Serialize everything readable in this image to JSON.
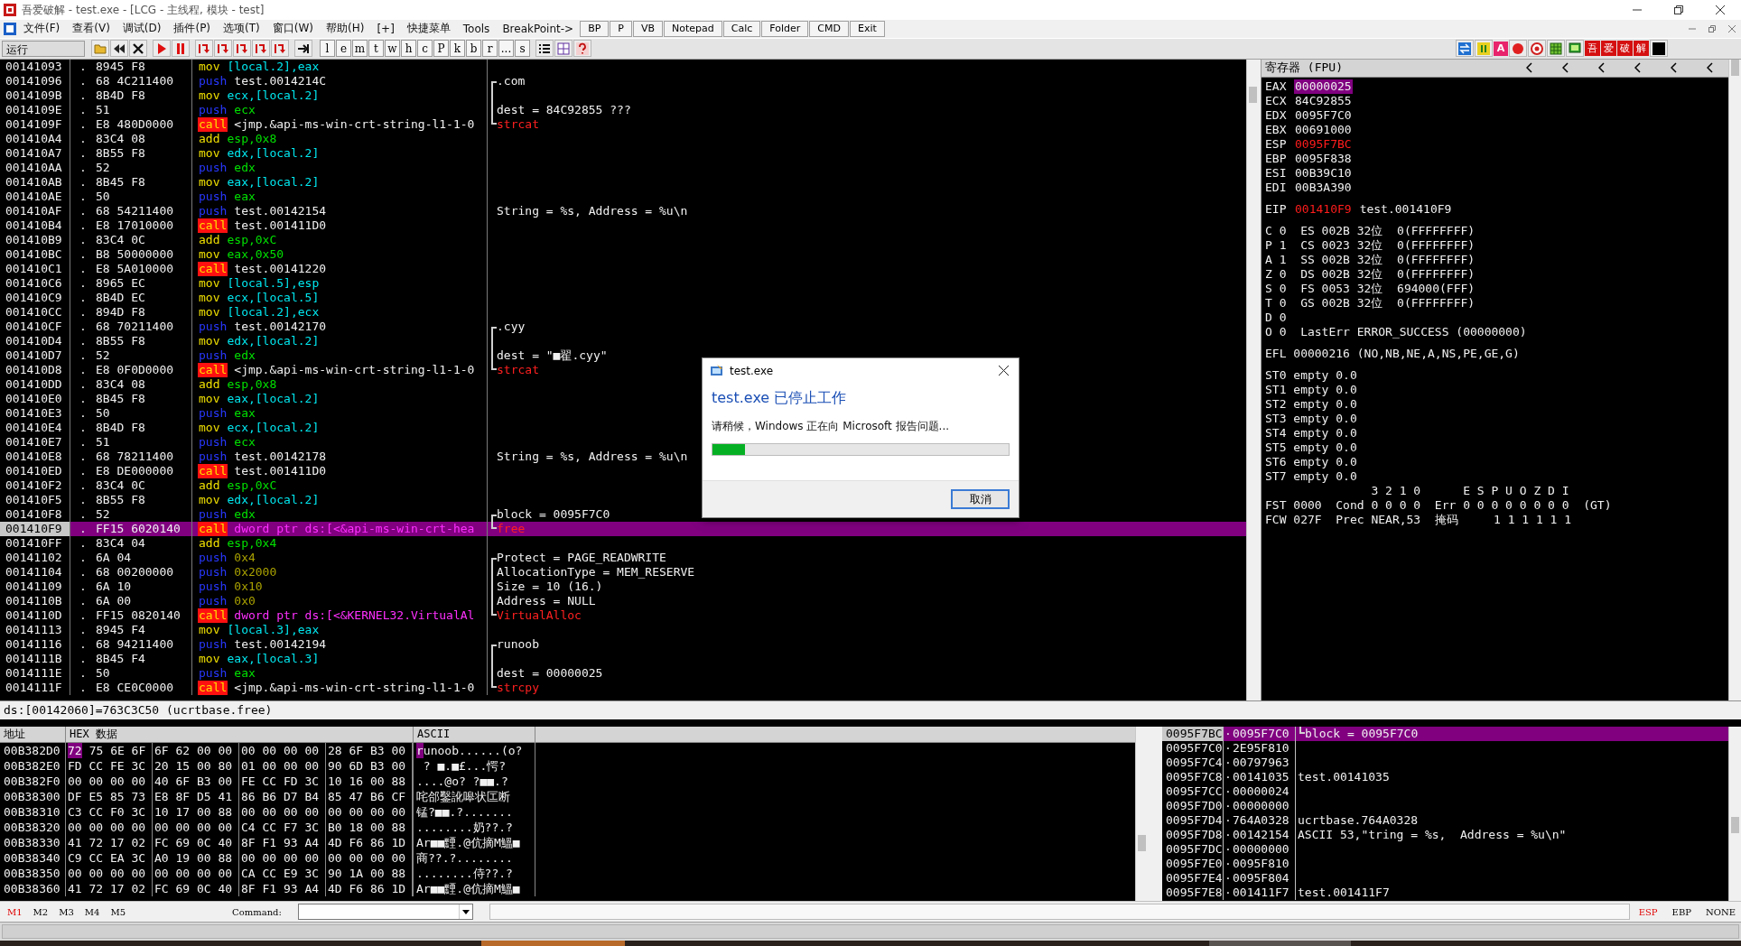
{
  "window": {
    "title": "吾爱破解 - test.exe - [LCG - 主线程, 模块 - test]"
  },
  "menu": {
    "items": [
      "文件(F)",
      "查看(V)",
      "调试(D)",
      "插件(P)",
      "选项(T)",
      "窗口(W)",
      "帮助(H)",
      "[+]",
      "快捷菜单",
      "Tools",
      "BreakPoint->"
    ],
    "quick_buttons": [
      "BP",
      "P",
      "VB",
      "Notepad",
      "Calc",
      "Folder",
      "CMD",
      "Exit"
    ]
  },
  "toolbar": {
    "status": "运行",
    "letter_buttons": [
      "l",
      "e",
      "m",
      "t",
      "w",
      "h",
      "c",
      "P",
      "k",
      "b",
      "r",
      "...",
      "s"
    ],
    "plugin_letter": "A",
    "brand_buttons": [
      "吾",
      "爱",
      "破",
      "解"
    ]
  },
  "disassembly": {
    "rows": [
      {
        "address": "00141093",
        "flag": ".",
        "hex": "8945 F8",
        "mnemonic": "mov",
        "operands": "[local.2],eax",
        "kind": "mov",
        "selected": false
      },
      {
        "address": "00141096",
        "flag": ".",
        "hex": "68 4C211400",
        "mnemonic": "push",
        "operands": "test.0014214C",
        "kind": "push_ref",
        "selected": false,
        "comment": {
          "text": ".com",
          "bracket": {
            "kind": "top"
          },
          "kind": "note"
        }
      },
      {
        "address": "0014109B",
        "flag": ".",
        "hex": "8B4D F8",
        "mnemonic": "mov",
        "operands": "ecx,[local.2]",
        "kind": "mov",
        "selected": false,
        "comment": {
          "bracket": {
            "kind": "mid"
          }
        }
      },
      {
        "address": "0014109E",
        "flag": ".",
        "hex": "51",
        "mnemonic": "push",
        "operands": "ecx",
        "kind": "push_reg",
        "selected": false,
        "comment": {
          "text": "dest = 84C92855 ???",
          "bracket": {
            "kind": "mid"
          },
          "kind": "note"
        }
      },
      {
        "address": "0014109F",
        "flag": ".",
        "hex": "E8 480D0000",
        "mnemonic": "call",
        "operands": "<jmp.&api-ms-win-crt-string-l1-1-0",
        "kind": "call",
        "selected": false,
        "comment": {
          "text": "strcat",
          "bracket": {
            "kind": "bottom"
          },
          "kind": "function"
        }
      },
      {
        "address": "001410A4",
        "flag": ".",
        "hex": "83C4 08",
        "mnemonic": "add",
        "operands": "esp,0x8",
        "kind": "add",
        "selected": false
      },
      {
        "address": "001410A7",
        "flag": ".",
        "hex": "8B55 F8",
        "mnemonic": "mov",
        "operands": "edx,[local.2]",
        "kind": "mov",
        "selected": false
      },
      {
        "address": "001410AA",
        "flag": ".",
        "hex": "52",
        "mnemonic": "push",
        "operands": "edx",
        "kind": "push_reg",
        "selected": false
      },
      {
        "address": "001410AB",
        "flag": ".",
        "hex": "8B45 F8",
        "mnemonic": "mov",
        "operands": "eax,[local.2]",
        "kind": "mov",
        "selected": false
      },
      {
        "address": "001410AE",
        "flag": ".",
        "hex": "50",
        "mnemonic": "push",
        "operands": "eax",
        "kind": "push_reg",
        "selected": false
      },
      {
        "address": "001410AF",
        "flag": ".",
        "hex": "68 54211400",
        "mnemonic": "push",
        "operands": "test.00142154",
        "kind": "push_ref",
        "selected": false,
        "comment": {
          "text": "String = %s,  Address = %u\\n",
          "kind": "note"
        }
      },
      {
        "address": "001410B4",
        "flag": ".",
        "hex": "E8 17010000",
        "mnemonic": "call",
        "operands": "test.001411D0",
        "kind": "call",
        "selected": false
      },
      {
        "address": "001410B9",
        "flag": ".",
        "hex": "83C4 0C",
        "mnemonic": "add",
        "operands": "esp,0xC",
        "kind": "add",
        "selected": false
      },
      {
        "address": "001410BC",
        "flag": ".",
        "hex": "B8 50000000",
        "mnemonic": "mov",
        "operands": "eax,0x50",
        "kind": "mov_imm",
        "selected": false
      },
      {
        "address": "001410C1",
        "flag": ".",
        "hex": "E8 5A010000",
        "mnemonic": "call",
        "operands": "test.00141220",
        "kind": "call",
        "selected": false
      },
      {
        "address": "001410C6",
        "flag": ".",
        "hex": "8965 EC",
        "mnemonic": "mov",
        "operands": "[local.5],esp",
        "kind": "mov",
        "selected": false
      },
      {
        "address": "001410C9",
        "flag": ".",
        "hex": "8B4D EC",
        "mnemonic": "mov",
        "operands": "ecx,[local.5]",
        "kind": "mov",
        "selected": false
      },
      {
        "address": "001410CC",
        "flag": ".",
        "hex": "894D F8",
        "mnemonic": "mov",
        "operands": "[local.2],ecx",
        "kind": "mov",
        "selected": false
      },
      {
        "address": "001410CF",
        "flag": ".",
        "hex": "68 70211400",
        "mnemonic": "push",
        "operands": "test.00142170",
        "kind": "push_ref",
        "selected": false,
        "comment": {
          "text": ".cyy",
          "bracket": {
            "kind": "top"
          },
          "kind": "note"
        }
      },
      {
        "address": "001410D4",
        "flag": ".",
        "hex": "8B55 F8",
        "mnemonic": "mov",
        "operands": "edx,[local.2]",
        "kind": "mov",
        "selected": false,
        "comment": {
          "bracket": {
            "kind": "mid"
          }
        }
      },
      {
        "address": "001410D7",
        "flag": ".",
        "hex": "52",
        "mnemonic": "push",
        "operands": "edx",
        "kind": "push_reg",
        "selected": false,
        "comment": {
          "text": "dest = \"■翟.cyy\"",
          "bracket": {
            "kind": "mid"
          },
          "kind": "note"
        }
      },
      {
        "address": "001410D8",
        "flag": ".",
        "hex": "E8 0F0D0000",
        "mnemonic": "call",
        "operands": "<jmp.&api-ms-win-crt-string-l1-1-0",
        "kind": "call",
        "selected": false,
        "comment": {
          "text": "strcat",
          "bracket": {
            "kind": "bottom"
          },
          "kind": "function"
        }
      },
      {
        "address": "001410DD",
        "flag": ".",
        "hex": "83C4 08",
        "mnemonic": "add",
        "operands": "esp,0x8",
        "kind": "add",
        "selected": false
      },
      {
        "address": "001410E0",
        "flag": ".",
        "hex": "8B45 F8",
        "mnemonic": "mov",
        "operands": "eax,[local.2]",
        "kind": "mov",
        "selected": false
      },
      {
        "address": "001410E3",
        "flag": ".",
        "hex": "50",
        "mnemonic": "push",
        "operands": "eax",
        "kind": "push_reg",
        "selected": false
      },
      {
        "address": "001410E4",
        "flag": ".",
        "hex": "8B4D F8",
        "mnemonic": "mov",
        "operands": "ecx,[local.2]",
        "kind": "mov",
        "selected": false
      },
      {
        "address": "001410E7",
        "flag": ".",
        "hex": "51",
        "mnemonic": "push",
        "operands": "ecx",
        "kind": "push_reg",
        "selected": false
      },
      {
        "address": "001410E8",
        "flag": ".",
        "hex": "68 78211400",
        "mnemonic": "push",
        "operands": "test.00142178",
        "kind": "push_ref",
        "selected": false,
        "comment": {
          "text": "String = %s,  Address = %u\\n",
          "kind": "note"
        }
      },
      {
        "address": "001410ED",
        "flag": ".",
        "hex": "E8 DE000000",
        "mnemonic": "call",
        "operands": "test.001411D0",
        "kind": "call",
        "selected": false
      },
      {
        "address": "001410F2",
        "flag": ".",
        "hex": "83C4 0C",
        "mnemonic": "add",
        "operands": "esp,0xC",
        "kind": "add",
        "selected": false
      },
      {
        "address": "001410F5",
        "flag": ".",
        "hex": "8B55 F8",
        "mnemonic": "mov",
        "operands": "edx,[local.2]",
        "kind": "mov",
        "selected": false
      },
      {
        "address": "001410F8",
        "flag": ".",
        "hex": "52",
        "mnemonic": "push",
        "operands": "edx",
        "kind": "push_reg",
        "selected": false,
        "comment": {
          "text": "block = 0095F7C0",
          "bracket": {
            "kind": "top"
          },
          "kind": "note"
        }
      },
      {
        "address": "001410F9",
        "flag": ".",
        "hex": "FF15 6020140",
        "mnemonic": "call",
        "operands": "dword ptr ds:[<&api-ms-win-crt-hea",
        "kind": "call_api",
        "selected": true,
        "comment": {
          "text": "free",
          "bracket": {
            "kind": "bottom"
          },
          "kind": "function"
        }
      },
      {
        "address": "001410FF",
        "flag": ".",
        "hex": "83C4 04",
        "mnemonic": "add",
        "operands": "esp,0x4",
        "kind": "add",
        "selected": false
      },
      {
        "address": "00141102",
        "flag": ".",
        "hex": "6A 04",
        "mnemonic": "push",
        "operands": "0x4",
        "kind": "push_imm",
        "selected": false,
        "comment": {
          "text": "Protect = PAGE_READWRITE",
          "bracket": {
            "kind": "top"
          },
          "kind": "note"
        }
      },
      {
        "address": "00141104",
        "flag": ".",
        "hex": "68 00200000",
        "mnemonic": "push",
        "operands": "0x2000",
        "kind": "push_imm",
        "selected": false,
        "comment": {
          "text": "AllocationType = MEM_RESERVE",
          "bracket": {
            "kind": "mid"
          },
          "kind": "note"
        }
      },
      {
        "address": "00141109",
        "flag": ".",
        "hex": "6A 10",
        "mnemonic": "push",
        "operands": "0x10",
        "kind": "push_imm",
        "selected": false,
        "comment": {
          "text": "Size = 10 (16.)",
          "bracket": {
            "kind": "mid"
          },
          "kind": "note"
        }
      },
      {
        "address": "0014110B",
        "flag": ".",
        "hex": "6A 00",
        "mnemonic": "push",
        "operands": "0x0",
        "kind": "push_imm",
        "selected": false,
        "comment": {
          "text": "Address = NULL",
          "bracket": {
            "kind": "mid"
          },
          "kind": "note"
        }
      },
      {
        "address": "0014110D",
        "flag": ".",
        "hex": "FF15 0820140",
        "mnemonic": "call",
        "operands": "dword ptr ds:[<&KERNEL32.VirtualAl",
        "kind": "call_api",
        "selected": false,
        "comment": {
          "text": "VirtualAlloc",
          "bracket": {
            "kind": "bottom"
          },
          "kind": "function"
        }
      },
      {
        "address": "00141113",
        "flag": ".",
        "hex": "8945 F4",
        "mnemonic": "mov",
        "operands": "[local.3],eax",
        "kind": "mov",
        "selected": false
      },
      {
        "address": "00141116",
        "flag": ".",
        "hex": "68 94211400",
        "mnemonic": "push",
        "operands": "test.00142194",
        "kind": "push_ref",
        "selected": false,
        "comment": {
          "text": "runoob",
          "bracket": {
            "kind": "top"
          },
          "kind": "note"
        }
      },
      {
        "address": "0014111B",
        "flag": ".",
        "hex": "8B45 F4",
        "mnemonic": "mov",
        "operands": "eax,[local.3]",
        "kind": "mov",
        "selected": false,
        "comment": {
          "bracket": {
            "kind": "mid"
          }
        }
      },
      {
        "address": "0014111E",
        "flag": ".",
        "hex": "50",
        "mnemonic": "push",
        "operands": "eax",
        "kind": "push_reg",
        "selected": false,
        "comment": {
          "text": "dest = 00000025",
          "bracket": {
            "kind": "mid"
          },
          "kind": "note"
        }
      },
      {
        "address": "0014111F",
        "flag": ".",
        "hex": "E8 CE0C0000",
        "mnemonic": "call",
        "operands": "<jmp.&api-ms-win-crt-string-l1-1-0",
        "kind": "call",
        "selected": false,
        "comment": {
          "text": "strcpy",
          "bracket": {
            "kind": "bottom"
          },
          "kind": "function"
        }
      }
    ]
  },
  "info_line": "ds:[00142060]=763C3C50 (ucrtbase.free)",
  "registers": {
    "title": "寄存器 (FPU)",
    "general": [
      {
        "name": "EAX",
        "value": "00000025",
        "selected": true,
        "changed": false
      },
      {
        "name": "ECX",
        "value": "84C92855",
        "selected": false,
        "changed": false
      },
      {
        "name": "EDX",
        "value": "0095F7C0",
        "selected": false,
        "changed": false
      },
      {
        "name": "EBX",
        "value": "00691000",
        "selected": false,
        "changed": false
      },
      {
        "name": "ESP",
        "value": "0095F7BC",
        "selected": false,
        "changed": true
      },
      {
        "name": "EBP",
        "value": "0095F838",
        "selected": false,
        "changed": false
      },
      {
        "name": "ESI",
        "value": "00B39C10",
        "selected": false,
        "changed": false
      },
      {
        "name": "EDI",
        "value": "00B3A390",
        "selected": false,
        "changed": false
      }
    ],
    "eip": {
      "name": "EIP",
      "value": "001410F9",
      "changed": true,
      "label": "test.001410F9"
    },
    "segments": [
      "C 0  ES 002B 32位  0(FFFFFFFF)",
      "P 1  CS 0023 32位  0(FFFFFFFF)",
      "A 1  SS 002B 32位  0(FFFFFFFF)",
      "Z 0  DS 002B 32位  0(FFFFFFFF)",
      "S 0  FS 0053 32位  694000(FFF)",
      "T 0  GS 002B 32位  0(FFFFFFFF)",
      "D 0",
      "O 0  LastErr ERROR_SUCCESS (00000000)"
    ],
    "efl": "EFL 00000216 (NO,NB,NE,A,NS,PE,GE,G)",
    "fpu": [
      "ST0 empty 0.0",
      "ST1 empty 0.0",
      "ST2 empty 0.0",
      "ST3 empty 0.0",
      "ST4 empty 0.0",
      "ST5 empty 0.0",
      "ST6 empty 0.0",
      "ST7 empty 0.0"
    ],
    "fpu_status": [
      "               3 2 1 0      E S P U O Z D I",
      "FST 0000  Cond 0 0 0 0  Err 0 0 0 0 0 0 0 0  (GT)",
      "FCW 027F  Prec NEAR,53  掩码     1 1 1 1 1 1"
    ]
  },
  "dump": {
    "columns": [
      "地址",
      "HEX 数据",
      "ASCII"
    ],
    "rows": [
      {
        "address": "00B382D0",
        "cursor_hex": "72",
        "hex": [
          "75 6E 6F",
          "6F 62 00 00",
          "00 00 00 00",
          "28 6F B3 00"
        ],
        "cursor_ascii": "r",
        "ascii": "unoob......(o?"
      },
      {
        "address": "00B382E0",
        "hex": [
          "FD CC FE 3C",
          "20 15 00 80",
          "01 00 00 00",
          "90 6D B3 00"
        ],
        "ascii": " ? ■.■£...愕?"
      },
      {
        "address": "00B382F0",
        "hex": [
          "00 00 00 00",
          "40 6F B3 00",
          "FE CC FD 3C",
          "10 16 00 88"
        ],
        "ascii": "....@o? ?■■.?"
      },
      {
        "address": "00B38300",
        "hex": [
          "DF E5 85 73",
          "E8 8F D5 41",
          "86 B6 D7 B4",
          "85 47 B6 CF"
        ],
        "ascii": "咤郃鑿訛嗥状匞断"
      },
      {
        "address": "00B38310",
        "hex": [
          "C3 CC F0 3C",
          "10 17 00 88",
          "00 00 00 00",
          "00 00 00 00"
        ],
        "ascii": "锰?■■.?......."
      },
      {
        "address": "00B38320",
        "hex": [
          "00 00 00 00",
          "00 00 00 00",
          "C4 CC F7 3C",
          "B0 18 00 88"
        ],
        "ascii": "........奶??.?"
      },
      {
        "address": "00B38330",
        "hex": [
          "41 72 17 02",
          "FC 69 0C 40",
          "8F F1 93 A4",
          "4D F6 86 1D"
        ],
        "ascii": "Ar■■黫.@伉摘M鰮■"
      },
      {
        "address": "00B38340",
        "hex": [
          "C9 CC EA 3C",
          "A0 19 00 88",
          "00 00 00 00",
          "00 00 00 00"
        ],
        "ascii": "商??.?........"
      },
      {
        "address": "00B38350",
        "hex": [
          "00 00 00 00",
          "00 00 00 00",
          "CA CC E9 3C",
          "90 1A 00 88"
        ],
        "ascii": "........侍??.?"
      },
      {
        "address": "00B38360",
        "hex": [
          "41 72 17 02",
          "FC 69 0C 40",
          "8F F1 93 A4",
          "4D F6 86 1D"
        ],
        "ascii": "Ar■■黫.@伉摘M鰮■"
      }
    ]
  },
  "stack": {
    "rows": [
      {
        "address": "0095F7BC",
        "flag": "·",
        "value": "0095F7C0",
        "comment": "block = 0095F7C0",
        "bracket": {
          "kind": "bottom"
        },
        "selected": true
      },
      {
        "address": "0095F7C0",
        "flag": "·",
        "value": "2E95F810",
        "selected": false
      },
      {
        "address": "0095F7C4",
        "flag": "·",
        "value": "00797963",
        "selected": false
      },
      {
        "address": "0095F7C8",
        "flag": "·",
        "value": "00141035",
        "comment": "test.00141035",
        "selected": false
      },
      {
        "address": "0095F7CC",
        "flag": "·",
        "value": "00000024",
        "selected": false
      },
      {
        "address": "0095F7D0",
        "flag": "·",
        "value": "00000000",
        "selected": false
      },
      {
        "address": "0095F7D4",
        "flag": "·",
        "value": "764A0328",
        "comment": "ucrtbase.764A0328",
        "selected": false
      },
      {
        "address": "0095F7D8",
        "flag": "·",
        "value": "00142154",
        "comment": "ASCII 53,\"tring = %s,  Address = %u\\n\"",
        "selected": false
      },
      {
        "address": "0095F7DC",
        "flag": "·",
        "value": "00000000",
        "selected": false
      },
      {
        "address": "0095F7E0",
        "flag": "·",
        "value": "0095F810",
        "selected": false
      },
      {
        "address": "0095F7E4",
        "flag": "·",
        "value": "0095F804",
        "selected": false
      },
      {
        "address": "0095F7E8",
        "flag": "·",
        "value": "001411F7",
        "comment": "test.001411F7",
        "selected": false
      }
    ]
  },
  "command_bar": {
    "memory_tabs": [
      {
        "label": "M1",
        "selected": true
      },
      {
        "label": "M2",
        "selected": false
      },
      {
        "label": "M3",
        "selected": false
      },
      {
        "label": "M4",
        "selected": false
      },
      {
        "label": "M5",
        "selected": false
      }
    ],
    "command_label": "Command:",
    "stack_modes": [
      {
        "label": "ESP",
        "selected": true
      },
      {
        "label": "EBP",
        "selected": false
      },
      {
        "label": "NONE",
        "selected": false
      }
    ]
  },
  "dialog": {
    "title": "test.exe",
    "heading": "test.exe 已停止工作",
    "message": "请稍候，Windows 正在向 Microsoft 报告问题...",
    "progress": {
      "level": 0.11
    },
    "button": "取消"
  }
}
